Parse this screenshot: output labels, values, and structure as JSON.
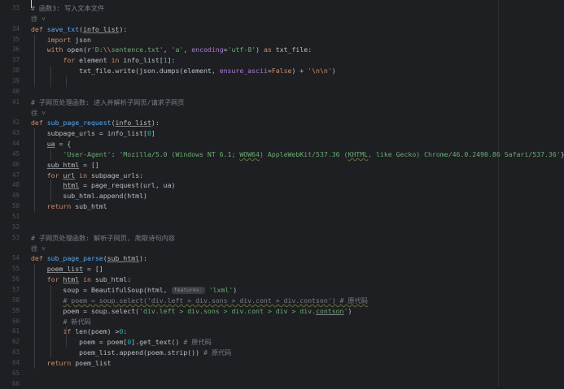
{
  "lines": [
    {
      "n": "33",
      "s": [
        [
          "cm",
          "# 函数3: 写入文本文件"
        ]
      ]
    },
    {
      "n": "",
      "s": [
        [
          "fold",
          "徐 ˅"
        ]
      ]
    },
    {
      "n": "34",
      "s": [
        [
          "kw",
          "def "
        ],
        [
          "fn",
          "save_txt"
        ],
        [
          "t",
          "("
        ],
        [
          "u",
          "info_list"
        ],
        [
          "t",
          "):"
        ]
      ]
    },
    {
      "n": "35",
      "s": [
        [
          "t",
          "    "
        ],
        [
          "kw",
          "import "
        ],
        [
          "t",
          "json"
        ]
      ]
    },
    {
      "n": "36",
      "s": [
        [
          "t",
          "    "
        ],
        [
          "kw",
          "with "
        ],
        [
          "t",
          "open(r"
        ],
        [
          "str",
          "'D:"
        ],
        [
          "esc",
          "\\\\"
        ],
        [
          "str",
          "sentence.txt'"
        ],
        [
          "t",
          ", "
        ],
        [
          "str",
          "'a'"
        ],
        [
          "t",
          ", "
        ],
        [
          "param",
          "encoding"
        ],
        [
          "t",
          "="
        ],
        [
          "str",
          "'utf-8'"
        ],
        [
          "t",
          ") "
        ],
        [
          "kw",
          "as "
        ],
        [
          "t",
          "txt_file:"
        ]
      ]
    },
    {
      "n": "37",
      "s": [
        [
          "t",
          "        "
        ],
        [
          "kw",
          "for "
        ],
        [
          "t",
          "element "
        ],
        [
          "kw",
          "in "
        ],
        [
          "t",
          "info_list["
        ],
        [
          "num",
          "1"
        ],
        [
          "t",
          "]:"
        ]
      ]
    },
    {
      "n": "38",
      "s": [
        [
          "t",
          "            txt_file.write(json.dumps(element, "
        ],
        [
          "param",
          "ensure_ascii"
        ],
        [
          "t",
          "="
        ],
        [
          "kw",
          "False"
        ],
        [
          "t",
          ") + "
        ],
        [
          "str",
          "'"
        ],
        [
          "esc",
          "\\n\\n"
        ],
        [
          "str",
          "'"
        ],
        [
          "t",
          ")"
        ]
      ]
    },
    {
      "n": "39",
      "s": []
    },
    {
      "n": "40",
      "s": []
    },
    {
      "n": "41",
      "s": [
        [
          "cm",
          "# 子网页处理函数: 进入并解析子网页/请求子网页"
        ]
      ]
    },
    {
      "n": "",
      "s": [
        [
          "fold",
          "徐 ˅"
        ]
      ]
    },
    {
      "n": "42",
      "s": [
        [
          "kw",
          "def "
        ],
        [
          "fn",
          "sub_page_request"
        ],
        [
          "t",
          "("
        ],
        [
          "u",
          "info_list"
        ],
        [
          "t",
          "):"
        ]
      ]
    },
    {
      "n": "43",
      "s": [
        [
          "t",
          "    subpage_urls = info_list["
        ],
        [
          "num",
          "0"
        ],
        [
          "t",
          "]"
        ]
      ]
    },
    {
      "n": "44",
      "s": [
        [
          "t",
          "    "
        ],
        [
          "u",
          "ua"
        ],
        [
          "t",
          " = {"
        ]
      ]
    },
    {
      "n": "45",
      "s": [
        [
          "t",
          "        "
        ],
        [
          "str",
          "'User-Agent'"
        ],
        [
          "t",
          ": "
        ],
        [
          "str",
          "'Mozilla/5.0 (Windows NT 6.1; "
        ],
        [
          "wavy",
          "WOW64"
        ],
        [
          "str",
          ") AppleWebKit/537.36 ("
        ],
        [
          "uwavy",
          "KHTML"
        ],
        [
          "str",
          ", like Gecko) Chrome/46.0.2490.86 Safari/537.36'"
        ],
        [
          "t",
          "}"
        ]
      ]
    },
    {
      "n": "46",
      "s": [
        [
          "t",
          "    "
        ],
        [
          "u",
          "sub_html"
        ],
        [
          "t",
          " = []"
        ]
      ]
    },
    {
      "n": "47",
      "s": [
        [
          "t",
          "    "
        ],
        [
          "kw",
          "for "
        ],
        [
          "u",
          "url"
        ],
        [
          "t",
          " "
        ],
        [
          "kw",
          "in "
        ],
        [
          "t",
          "subpage_urls:"
        ]
      ]
    },
    {
      "n": "48",
      "s": [
        [
          "t",
          "        "
        ],
        [
          "u",
          "html"
        ],
        [
          "t",
          " = page_request(url, ua)"
        ]
      ]
    },
    {
      "n": "49",
      "s": [
        [
          "t",
          "        sub_html.append(html)"
        ]
      ]
    },
    {
      "n": "50",
      "s": [
        [
          "t",
          "    "
        ],
        [
          "kw",
          "return "
        ],
        [
          "t",
          "sub_html"
        ]
      ]
    },
    {
      "n": "51",
      "s": []
    },
    {
      "n": "52",
      "s": []
    },
    {
      "n": "53",
      "s": [
        [
          "cm",
          "# 子网页处理函数: 解析子网页, 爬取诗句内容"
        ]
      ]
    },
    {
      "n": "",
      "s": [
        [
          "fold",
          "徐 ˅"
        ]
      ]
    },
    {
      "n": "54",
      "s": [
        [
          "kw",
          "def "
        ],
        [
          "fn",
          "sub_page_parse"
        ],
        [
          "t",
          "("
        ],
        [
          "u",
          "sub_html"
        ],
        [
          "t",
          "):"
        ]
      ]
    },
    {
      "n": "55",
      "s": [
        [
          "t",
          "    "
        ],
        [
          "u",
          "poem_list"
        ],
        [
          "t",
          " = []"
        ]
      ]
    },
    {
      "n": "56",
      "s": [
        [
          "t",
          "    "
        ],
        [
          "kw",
          "for "
        ],
        [
          "u",
          "html"
        ],
        [
          "t",
          " "
        ],
        [
          "kw",
          "in "
        ],
        [
          "t",
          "sub_html:"
        ]
      ]
    },
    {
      "n": "57",
      "s": [
        [
          "t",
          "        soup = BeautifulSoup(html, "
        ],
        [
          "hint",
          "features:"
        ],
        [
          "t",
          " "
        ],
        [
          "str",
          "'lxml'"
        ],
        [
          "t",
          ")"
        ]
      ]
    },
    {
      "n": "58",
      "s": [
        [
          "t",
          "        "
        ],
        [
          "cmw",
          "# poem = soup.select('div.left > div.sons > div.cont > div.contson') # 原代码"
        ]
      ]
    },
    {
      "n": "59",
      "s": [
        [
          "t",
          "        poem = soup.select("
        ],
        [
          "str",
          "'div.left > div.sons > div.cont > div > div."
        ],
        [
          "ustr",
          "contson"
        ],
        [
          "str",
          "'"
        ],
        [
          "t",
          ")"
        ]
      ]
    },
    {
      "n": "60",
      "s": [
        [
          "t",
          "        "
        ],
        [
          "cm",
          "# 新代码"
        ]
      ]
    },
    {
      "n": "61",
      "s": [
        [
          "t",
          "        "
        ],
        [
          "kw",
          "if "
        ],
        [
          "t",
          "len(poem) >"
        ],
        [
          "num",
          "0"
        ],
        [
          "t",
          ":"
        ]
      ]
    },
    {
      "n": "62",
      "s": [
        [
          "t",
          "            poem = poem["
        ],
        [
          "num",
          "0"
        ],
        [
          "t",
          "].get_text() "
        ],
        [
          "cm",
          "# 原代码"
        ]
      ]
    },
    {
      "n": "63",
      "s": [
        [
          "t",
          "            poem_list.append(poem.strip()) "
        ],
        [
          "cm",
          "# 原代码"
        ]
      ]
    },
    {
      "n": "64",
      "s": [
        [
          "t",
          "    "
        ],
        [
          "kw",
          "return "
        ],
        [
          "t",
          "poem_list"
        ]
      ]
    },
    {
      "n": "65",
      "s": []
    },
    {
      "n": "66",
      "s": []
    }
  ]
}
